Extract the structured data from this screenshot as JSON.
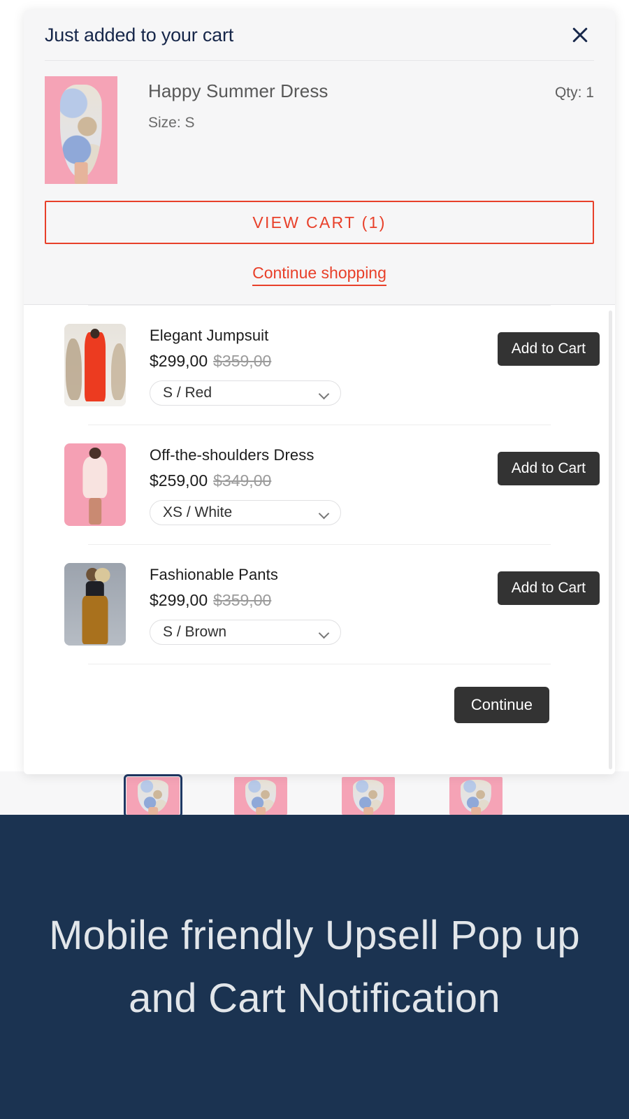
{
  "cart_notification": {
    "title": "Just added to your cart",
    "close_icon": "close-icon",
    "item": {
      "name": "Happy Summer Dress",
      "variant": "Size: S",
      "qty": "Qty: 1"
    },
    "view_cart_label": "VIEW CART (1)",
    "continue_shopping_label": "Continue shopping",
    "accent_color": "#e8402a",
    "title_color": "#17274a",
    "background": "#f6f6f7"
  },
  "upsell": {
    "products": [
      {
        "name": "Elegant Jumpsuit",
        "price": "$299,00",
        "compare_at_price": "$359,00",
        "variant": "S / Red",
        "add_label": "Add to Cart"
      },
      {
        "name": "Off-the-shoulders Dress",
        "price": "$259,00",
        "compare_at_price": "$349,00",
        "variant": "XS / White",
        "add_label": "Add to Cart"
      },
      {
        "name": "Fashionable Pants",
        "price": "$299,00",
        "compare_at_price": "$359,00",
        "variant": "S / Brown",
        "add_label": "Add to Cart"
      }
    ],
    "continue_label": "Continue",
    "button_color": "#333333"
  },
  "product_page": {
    "thumbnails": [
      {
        "selected": true
      },
      {
        "selected": false
      },
      {
        "selected": false
      },
      {
        "selected": false
      }
    ],
    "selected_border_color": "#1f3864"
  },
  "footer_banner": {
    "text": "Mobile friendly Upsell Pop up and Cart Notification",
    "background": "#1b3351",
    "text_color": "#e2e6ea"
  }
}
